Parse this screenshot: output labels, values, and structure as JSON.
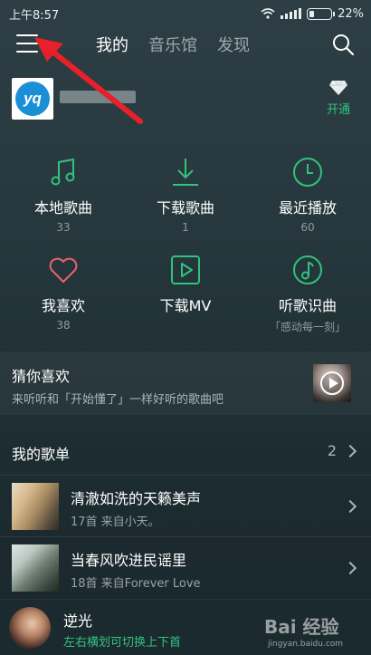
{
  "status_bar": {
    "time": "上午8:57",
    "battery": "22%"
  },
  "header": {
    "tabs": [
      {
        "label": "我的",
        "active": true
      },
      {
        "label": "音乐馆",
        "active": false
      },
      {
        "label": "发现",
        "active": false
      }
    ]
  },
  "profile": {
    "avatar_text": "yq",
    "vip_label": "开通"
  },
  "grid": [
    {
      "label": "本地歌曲",
      "sub": "33",
      "icon": "music-note-icon"
    },
    {
      "label": "下载歌曲",
      "sub": "1",
      "icon": "download-icon"
    },
    {
      "label": "最近播放",
      "sub": "60",
      "icon": "clock-icon"
    },
    {
      "label": "我喜欢",
      "sub": "38",
      "icon": "heart-icon"
    },
    {
      "label": "下载MV",
      "sub": "",
      "icon": "mv-play-icon"
    },
    {
      "label": "听歌识曲",
      "sub": "「感动每一刻」",
      "icon": "music-recognition-icon"
    }
  ],
  "guess": {
    "title": "猜你喜欢",
    "subtitle": "来听听和「开始懂了」一样好听的歌曲吧"
  },
  "playlists": {
    "header": "我的歌单",
    "count": "2",
    "items": [
      {
        "title": "清澈如洗的天籁美声",
        "subtitle": "17首 来自小天。"
      },
      {
        "title": "当春风吹进民谣里",
        "subtitle": "18首 来自Forever Love"
      }
    ]
  },
  "player": {
    "title": "逆光",
    "hint": "左右横划可切换上下首"
  },
  "watermark": {
    "text": "Bai 经验",
    "sub": "jingyan.baidu.com"
  },
  "colors": {
    "accent": "#31c27c",
    "annotation": "#e8202a"
  }
}
